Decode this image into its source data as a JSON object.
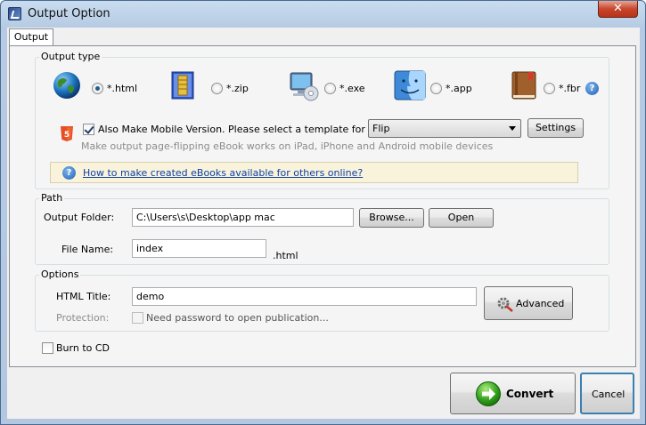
{
  "window": {
    "title": "Output Option",
    "close_glyph": "✕"
  },
  "tabs": [
    {
      "label": "Output"
    }
  ],
  "output_type": {
    "group_label": "Output type",
    "options": [
      {
        "label": "*.html",
        "icon": "globe-icon",
        "selected": true
      },
      {
        "label": "*.zip",
        "icon": "zip-archive-icon",
        "selected": false
      },
      {
        "label": "*.exe",
        "icon": "computer-cd-icon",
        "selected": false
      },
      {
        "label": "*.app",
        "icon": "mac-finder-icon",
        "selected": false
      },
      {
        "label": "*.fbr",
        "icon": "book-icon",
        "selected": false
      }
    ],
    "mobile_checkbox_label": "Also Make Mobile Version. Please select a template for mobile:",
    "mobile_template": "Flip",
    "settings_label": "Settings",
    "mobile_hint": "Make output page-flipping eBook works on iPad, iPhone and Android mobile devices",
    "help_link": "How to make created eBooks available for others online?"
  },
  "path": {
    "group_label": "Path",
    "output_folder_label": "Output Folder:",
    "output_folder_value": "C:\\Users\\s\\Desktop\\app mac",
    "browse_label": "Browse...",
    "open_label": "Open",
    "file_name_label": "File Name:",
    "file_name_value": "index",
    "extension": ".html"
  },
  "options": {
    "group_label": "Options",
    "html_title_label": "HTML Title:",
    "html_title_value": "demo",
    "advanced_label": "Advanced",
    "protection_label": "Protection:",
    "password_label": "Need password to open publication..."
  },
  "burn_cd_label": "Burn to CD",
  "footer": {
    "convert_label": "Convert",
    "cancel_label": "Cancel"
  },
  "colors": {
    "link": "#0b3fa8",
    "info_bar": "#faf3dc",
    "disabled_text": "#8c8c8c"
  }
}
